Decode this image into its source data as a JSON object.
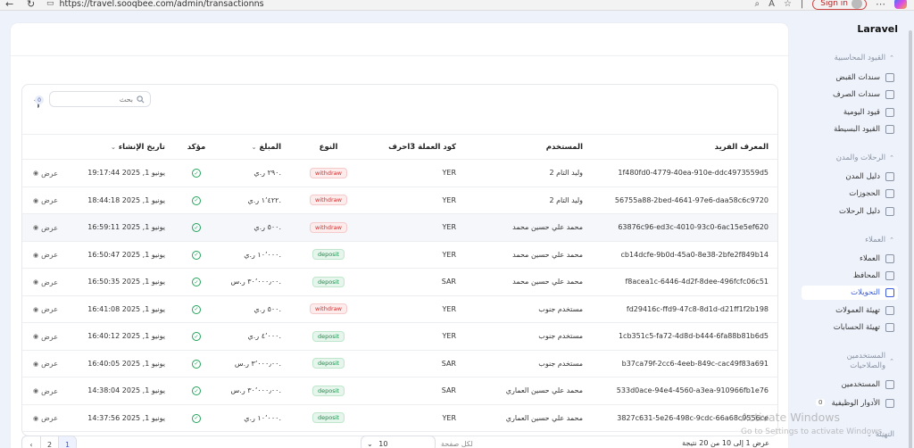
{
  "browser": {
    "url": "https://travel.sooqbee.com/admin/transactionns",
    "signin_label": "Sign in"
  },
  "app": {
    "brand": "Laravel"
  },
  "toolbar": {
    "filter_count": "0",
    "search_placeholder": "بحث"
  },
  "table": {
    "columns": {
      "id": "المعرف الفريد",
      "user": "المستخدم",
      "currency": "كود العملة 3احرف",
      "type": "النوع",
      "amount": "المبلغ",
      "confirmed": "مؤكد",
      "created": "تاريخ الإنشاء"
    },
    "view_label": "عرض",
    "rows": [
      {
        "id": "1f480fd0-4779-40ea-910e-ddc4973559d5",
        "user": "وليد التام 2",
        "currency": "YER",
        "type": "withdraw",
        "amount": "٢٩٠ ر.ي.",
        "created": "يونيو 1, 2025 19:17:44"
      },
      {
        "id": "56755a88-2bed-4641-97e6-daa58c6c9720",
        "user": "وليد التام 2",
        "currency": "YER",
        "type": "withdraw",
        "amount": "١٬٤٢٢ ر.ي.",
        "created": "يونيو 1, 2025 18:44:18"
      },
      {
        "id": "63876c96-ed3c-4010-93c0-6ac15e5ef620",
        "user": "محمد علي حسين محمد",
        "currency": "YER",
        "type": "withdraw",
        "amount": "٥٠٠ ر.ي.",
        "created": "يونيو 1, 2025 16:59:11"
      },
      {
        "id": "cb14dcfe-9b0d-45a0-8e38-2bfe2f849b14",
        "user": "محمد علي حسين محمد",
        "currency": "YER",
        "type": "deposit",
        "amount": "١٠٬٠٠٠ ر.ي.",
        "created": "يونيو 1, 2025 16:50:47"
      },
      {
        "id": "f8acea1c-6446-4d2f-8dee-496fcfc06c51",
        "user": "محمد علي حسين محمد",
        "currency": "SAR",
        "type": "deposit",
        "amount": "٣٠٬٠٠٠٫٠٠ ر.س.",
        "created": "يونيو 1, 2025 16:50:35"
      },
      {
        "id": "fd29416c-ffd9-47c8-8d1d-d21ff1f2b198",
        "user": "مستخدم جنوب",
        "currency": "YER",
        "type": "withdraw",
        "amount": "٥٠٠ ر.ي.",
        "created": "يونيو 1, 2025 16:41:08"
      },
      {
        "id": "1cb351c5-fa72-4d8d-b444-6fa88b81b6d5",
        "user": "مستخدم جنوب",
        "currency": "YER",
        "type": "deposit",
        "amount": "٤٬٠٠٠ ر.ي.",
        "created": "يونيو 1, 2025 16:40:12"
      },
      {
        "id": "b37ca79f-2cc6-4eeb-849c-cac49f83a691",
        "user": "مستخدم جنوب",
        "currency": "SAR",
        "type": "deposit",
        "amount": "٣٬٠٠٠٫٠٠ ر.س.",
        "created": "يونيو 1, 2025 16:40:05"
      },
      {
        "id": "533d0ace-94e4-4560-a3ea-910966fb1e76",
        "user": "محمد علي حسين العماري",
        "currency": "SAR",
        "type": "deposit",
        "amount": "٣٠٬٠٠٠٫٠٠ ر.س.",
        "created": "يونيو 1, 2025 14:38:04"
      },
      {
        "id": "3827c631-5e26-498c-9cdc-66a68c9556ce",
        "user": "محمد علي حسين العماري",
        "currency": "YER",
        "type": "deposit",
        "amount": "١٠٬٠٠٠ ر.ي.",
        "created": "يونيو 1, 2025 14:37:56"
      }
    ]
  },
  "pagination": {
    "page_1": "1",
    "page_2": "2",
    "per_page_value": "10",
    "per_page_label": "لكل صفحة",
    "result_text": "عرض 1 إلى 10 من 20 نتيجة"
  },
  "sidebar": {
    "group_accounting": "القيود المحاسبية",
    "receipts": "سندات القبض",
    "payments": "سندات الصرف",
    "daily_entries": "قيود اليومية",
    "simple_entries": "القيود البسيطة",
    "group_trips": "الرحلات والمدن",
    "city_guide": "دليل المدن",
    "bookings": "الحجوزات",
    "trips_guide": "دليل الرحلات",
    "group_clients": "العملاء",
    "clients": "العملاء",
    "wallets": "المحافظ",
    "transfers": "التحويلات",
    "commission_setup": "تهيئة العمولات",
    "accounts_setup": "تهيئة الحسابات",
    "group_users": "المستخدمين والصلاحيات",
    "users": "المستخدمين",
    "roles": "الأدوار الوظيفية",
    "roles_count": "0",
    "group_setup": "التهيئة"
  },
  "overlay": {
    "watermark_title": "Activate Windows",
    "watermark_sub": "Go to Settings to activate Windows."
  }
}
